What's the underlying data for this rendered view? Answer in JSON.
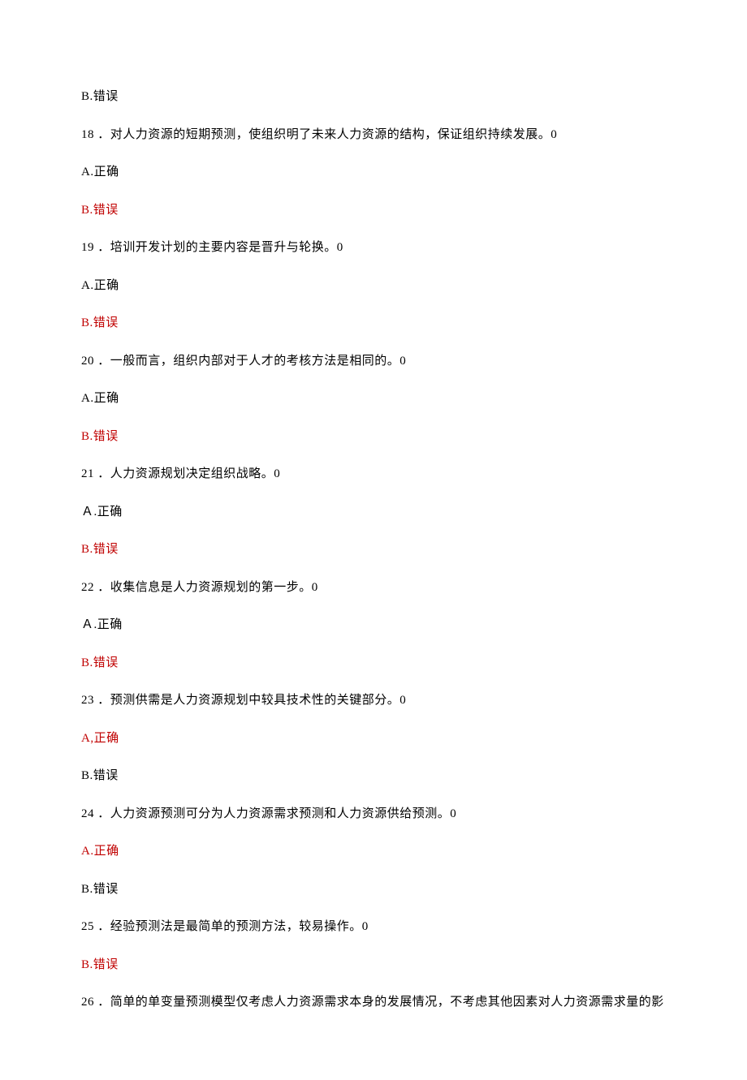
{
  "items": [
    {
      "kind": "option",
      "text": "B.错误",
      "highlight": false
    },
    {
      "kind": "question",
      "num": "18",
      "text": "．对人力资源的短期预测，使组织明了未来人力资源的结构，保证组织持续发展。0"
    },
    {
      "kind": "option",
      "text": "A.正确",
      "highlight": false
    },
    {
      "kind": "option",
      "text": "B.错误",
      "highlight": true
    },
    {
      "kind": "question",
      "num": "19",
      "text": "．培训开发计划的主要内容是晋升与轮换。0"
    },
    {
      "kind": "option",
      "text": "A.正确",
      "highlight": false
    },
    {
      "kind": "option",
      "text": "B.错误",
      "highlight": true
    },
    {
      "kind": "question",
      "num": "20",
      "text": "．一般而言，组织内部对于人才的考核方法是相同的。0"
    },
    {
      "kind": "option",
      "text": "A.正确",
      "highlight": false
    },
    {
      "kind": "option",
      "text": "B.错误",
      "highlight": true
    },
    {
      "kind": "question",
      "num": "21",
      "text": "．人力资源规划决定组织战略。0"
    },
    {
      "kind": "option",
      "text": "Ａ.正确",
      "highlight": false
    },
    {
      "kind": "option",
      "text": "B.错误",
      "highlight": true
    },
    {
      "kind": "question",
      "num": "22",
      "text": "．收集信息是人力资源规划的第一步。0"
    },
    {
      "kind": "option",
      "text": "Ａ.正确",
      "highlight": false
    },
    {
      "kind": "option",
      "text": "B.错误",
      "highlight": true
    },
    {
      "kind": "question",
      "num": "23",
      "text": "．预测供需是人力资源规划中较具技术性的关键部分。0"
    },
    {
      "kind": "option",
      "text": "A,正确",
      "highlight": true
    },
    {
      "kind": "option",
      "text": "B.错误",
      "highlight": false
    },
    {
      "kind": "question",
      "num": "24",
      "text": "．人力资源预测可分为人力资源需求预测和人力资源供给预测。0"
    },
    {
      "kind": "option",
      "text": "A.正确",
      "highlight": true
    },
    {
      "kind": "option",
      "text": "B.错误",
      "highlight": false
    },
    {
      "kind": "question",
      "num": "25",
      "text": "．经验预测法是最简单的预测方法，较易操作。0"
    },
    {
      "kind": "option",
      "text": "B.错误",
      "highlight": true
    },
    {
      "kind": "question",
      "num": "26",
      "text": "．简单的单变量预测模型仅考虑人力资源需求本身的发展情况，不考虑其他因素对人力资源需求量的影"
    }
  ]
}
